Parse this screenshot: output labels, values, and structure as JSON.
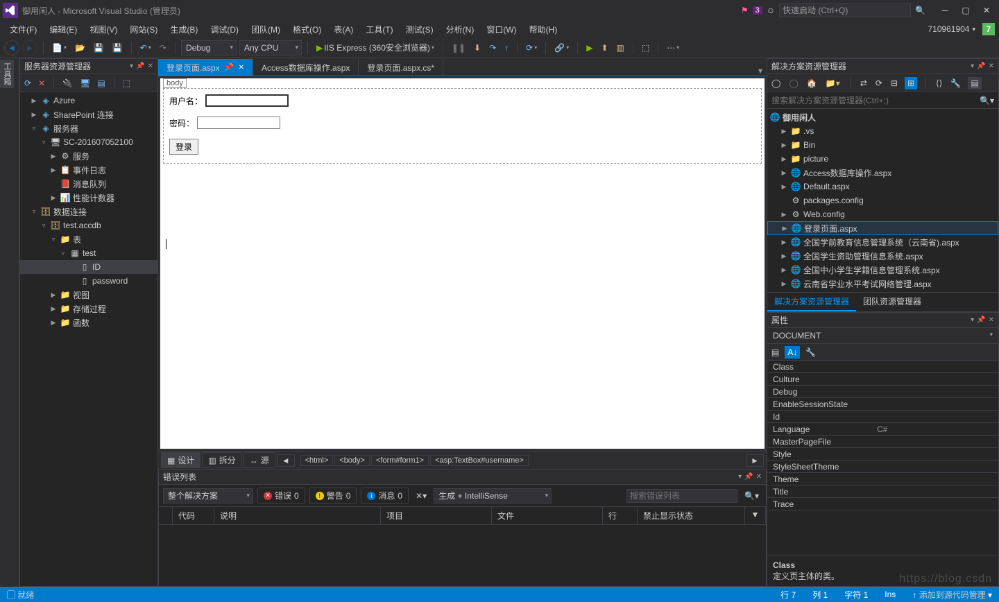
{
  "titlebar": {
    "app_title": "御用闲人 - Microsoft Visual Studio (管理员)",
    "badge": "3",
    "quick_launch_placeholder": "快速启动 (Ctrl+Q)",
    "right_number": "710961904",
    "green_badge": "7"
  },
  "menu": [
    "文件(F)",
    "编辑(E)",
    "视图(V)",
    "网站(S)",
    "生成(B)",
    "调试(D)",
    "团队(M)",
    "格式(O)",
    "表(A)",
    "工具(T)",
    "测试(S)",
    "分析(N)",
    "窗口(W)",
    "帮助(H)"
  ],
  "toolbar": {
    "config": "Debug",
    "platform": "Any CPU",
    "run_label": "IIS Express (360安全浏览器)"
  },
  "server_explorer": {
    "title": "服务器资源管理器",
    "tree": [
      {
        "d": 1,
        "tw": "▶",
        "i": "blue",
        "t": "Azure"
      },
      {
        "d": 1,
        "tw": "▶",
        "i": "blue",
        "t": "SharePoint 连接"
      },
      {
        "d": 1,
        "tw": "▿",
        "i": "blue",
        "t": "服务器"
      },
      {
        "d": 2,
        "tw": "▿",
        "i": "srv",
        "t": "SC-201607052100"
      },
      {
        "d": 3,
        "tw": "▶",
        "i": "svc",
        "t": "服务"
      },
      {
        "d": 3,
        "tw": "▶",
        "i": "log",
        "t": "事件日志"
      },
      {
        "d": 3,
        "tw": "",
        "i": "red",
        "t": "消息队列"
      },
      {
        "d": 3,
        "tw": "▶",
        "i": "perf",
        "t": "性能计数器"
      },
      {
        "d": 1,
        "tw": "▿",
        "i": "db",
        "t": "数据连接"
      },
      {
        "d": 2,
        "tw": "▿",
        "i": "db",
        "t": "test.accdb"
      },
      {
        "d": 3,
        "tw": "▿",
        "i": "folder",
        "t": "表"
      },
      {
        "d": 4,
        "tw": "▿",
        "i": "tbl",
        "t": "test"
      },
      {
        "d": 5,
        "tw": "",
        "i": "col",
        "t": "ID",
        "sel": true
      },
      {
        "d": 5,
        "tw": "",
        "i": "col",
        "t": "password"
      },
      {
        "d": 3,
        "tw": "▶",
        "i": "folder",
        "t": "视图"
      },
      {
        "d": 3,
        "tw": "▶",
        "i": "folder",
        "t": "存储过程"
      },
      {
        "d": 3,
        "tw": "▶",
        "i": "folder",
        "t": "函数"
      }
    ]
  },
  "editor": {
    "tabs": [
      {
        "label": "登录页面.aspx",
        "active": true,
        "pinned": true
      },
      {
        "label": "Access数据库操作.aspx",
        "active": false
      },
      {
        "label": "登录页面.aspx.cs*",
        "active": false
      }
    ],
    "body_tag": "body",
    "form": {
      "username_label": "用户名：",
      "password_label": "密码：",
      "login_button": "登录"
    },
    "footer": {
      "design": "设计",
      "split": "拆分",
      "source": "源",
      "breadcrumb": [
        "<html>",
        "<body>",
        "<form#form1>",
        "<asp:TextBox#username>"
      ]
    }
  },
  "error_list": {
    "title": "错误列表",
    "scope": "整个解决方案",
    "errors_label": "错误",
    "errors": "0",
    "warnings_label": "警告",
    "warnings": "0",
    "messages_label": "消息",
    "messages": "0",
    "build_filter": "生成 + IntelliSense",
    "search_placeholder": "搜索错误列表",
    "columns": [
      "代码",
      "说明",
      "项目",
      "文件",
      "行",
      "禁止显示状态"
    ]
  },
  "solution": {
    "title": "解决方案资源管理器",
    "search_placeholder": "搜索解决方案资源管理器(Ctrl+;)",
    "root": "御用闲人",
    "tree": [
      {
        "d": 1,
        "tw": "▶",
        "i": "folder",
        "t": ".vs"
      },
      {
        "d": 1,
        "tw": "▶",
        "i": "folder",
        "t": "Bin"
      },
      {
        "d": 1,
        "tw": "▶",
        "i": "folder",
        "t": "picture"
      },
      {
        "d": 1,
        "tw": "▶",
        "i": "aspx",
        "t": "Access数据库操作.aspx"
      },
      {
        "d": 1,
        "tw": "▶",
        "i": "aspx",
        "t": "Default.aspx"
      },
      {
        "d": 1,
        "tw": "",
        "i": "cfg",
        "t": "packages.config"
      },
      {
        "d": 1,
        "tw": "▶",
        "i": "cfg",
        "t": "Web.config"
      },
      {
        "d": 1,
        "tw": "▶",
        "i": "aspx",
        "t": "登录页面.aspx",
        "hl": true
      },
      {
        "d": 1,
        "tw": "▶",
        "i": "aspx",
        "t": "全国学前教育信息管理系统（云南省).aspx"
      },
      {
        "d": 1,
        "tw": "▶",
        "i": "aspx",
        "t": "全国学生资助管理信息系统.aspx"
      },
      {
        "d": 1,
        "tw": "▶",
        "i": "aspx",
        "t": "全国中小学生学籍信息管理系统.aspx"
      },
      {
        "d": 1,
        "tw": "▶",
        "i": "aspx",
        "t": "云南省学业水平考试网络管理.aspx"
      }
    ],
    "tabs": [
      "解决方案资源管理器",
      "团队资源管理器"
    ]
  },
  "properties": {
    "title": "属性",
    "category": "DOCUMENT",
    "rows": [
      {
        "k": "Class",
        "v": ""
      },
      {
        "k": "Culture",
        "v": ""
      },
      {
        "k": "Debug",
        "v": ""
      },
      {
        "k": "EnableSessionState",
        "v": ""
      },
      {
        "k": "Id",
        "v": ""
      },
      {
        "k": "Language",
        "v": "C#"
      },
      {
        "k": "MasterPageFile",
        "v": ""
      },
      {
        "k": "Style",
        "v": ""
      },
      {
        "k": "StyleSheetTheme",
        "v": ""
      },
      {
        "k": "Theme",
        "v": ""
      },
      {
        "k": "Title",
        "v": ""
      },
      {
        "k": "Trace",
        "v": ""
      }
    ],
    "desc_head": "Class",
    "desc_body": "定义页主体的类。"
  },
  "statusbar": {
    "ready": "就绪",
    "line": "行 7",
    "col": "列 1",
    "ch": "字符 1",
    "ins": "Ins",
    "scm": "添加到源代码管理"
  },
  "left_margin": "工具箱",
  "watermark": "https://blog.csdn"
}
